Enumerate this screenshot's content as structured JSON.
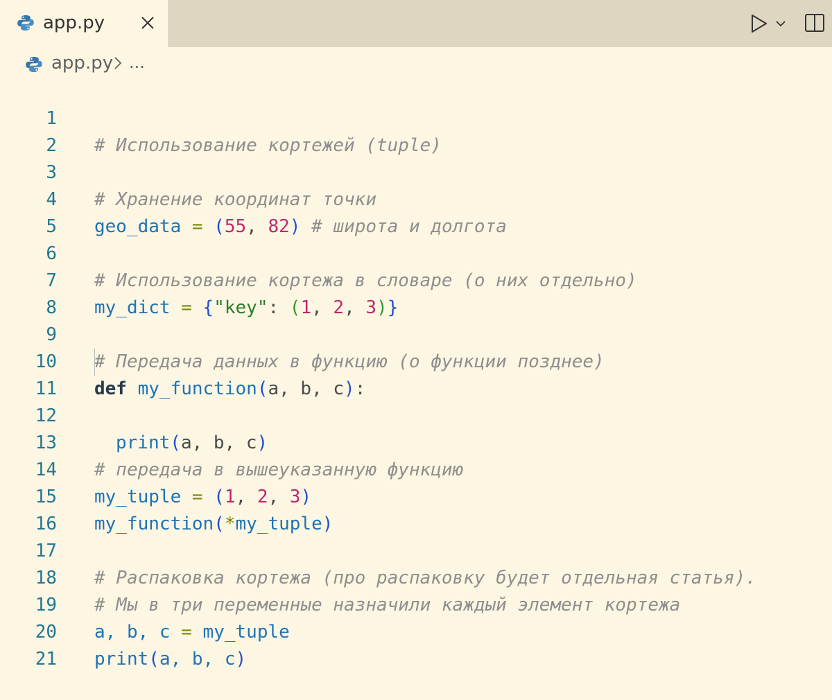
{
  "tab": {
    "filename": "app.py",
    "icon": "python-icon",
    "close": "close-icon"
  },
  "toolbar": {
    "run": "run-icon",
    "run_menu": "chevron-down-icon",
    "split": "split-editor-icon"
  },
  "breadcrumb": {
    "file": "app.py",
    "more": "..."
  },
  "line_numbers": [
    "1",
    "2",
    "3",
    "4",
    "5",
    "6",
    "7",
    "8",
    "9",
    "10",
    "11",
    "12",
    "13",
    "14",
    "15",
    "16",
    "17",
    "18",
    "19",
    "20",
    "21"
  ],
  "code": {
    "l1": {
      "comment": "# Использование кортежей (tuple)"
    },
    "l3": {
      "comment": "# Хранение координат точки"
    },
    "l4": {
      "var": "geo_data",
      "eq": "=",
      "open": "(",
      "n1": "55",
      "sep": ",",
      "n2": "82",
      "close": ")",
      "comment": "# широта и долгота"
    },
    "l6": {
      "comment": "# Использование кортежа в словаре (о них отдельно)"
    },
    "l7": {
      "var": "my_dict",
      "eq": "=",
      "brace_open": "{",
      "key": "\"key\"",
      "colon": ":",
      "paren_open": "(",
      "n1": "1",
      "sep1": ",",
      "n2": "2",
      "sep2": ",",
      "n3": "3",
      "paren_close": ")",
      "brace_close": "}"
    },
    "l9": {
      "comment": "# Передача данных в функцию (о функции позднее)"
    },
    "l10": {
      "kw": "def",
      "name": "my_function",
      "open": "(",
      "params": "a, b, c",
      "close": ")",
      "colon": ":"
    },
    "l11": {
      "fn": "print",
      "open": "(",
      "args": "a, b, c",
      "close": ")"
    },
    "l13": {
      "comment": "# передача в вышеуказанную функцию"
    },
    "l14": {
      "var": "my_tuple",
      "eq": "=",
      "open": "(",
      "n1": "1",
      "sep1": ",",
      "n2": "2",
      "sep2": ",",
      "n3": "3",
      "close": ")"
    },
    "l15": {
      "fn": "my_function",
      "open": "(",
      "star": "*",
      "arg": "my_tuple",
      "close": ")"
    },
    "l17": {
      "comment": "# Распаковка кортежа (про распаковку будет отдельная статья)."
    },
    "l18": {
      "comment": "# Мы в три переменные назначили каждый элемент кортежа"
    },
    "l19": {
      "targets": "a, b, c",
      "eq": "=",
      "value": "my_tuple"
    },
    "l20": {
      "fn": "print",
      "open": "(",
      "args": "a, b, c",
      "close": ")"
    }
  }
}
